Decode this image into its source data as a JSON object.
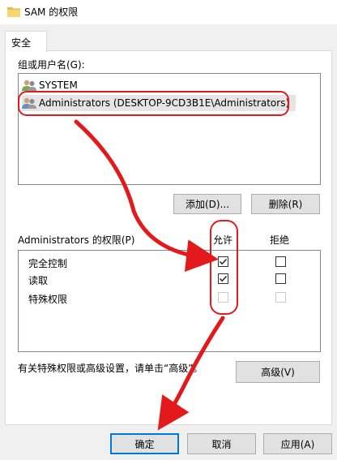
{
  "window": {
    "title": "SAM 的权限"
  },
  "tabs": [
    {
      "label": "安全"
    }
  ],
  "groups": {
    "label": "组或用户名(G):",
    "items": [
      {
        "name": "SYSTEM"
      },
      {
        "name": "Administrators (DESKTOP-9CD3B1E\\Administrators)"
      }
    ]
  },
  "buttons": {
    "add": "添加(D)...",
    "remove": "删除(R)",
    "advanced": "高级(V)",
    "ok": "确定",
    "cancel": "取消",
    "apply": "应用(A)"
  },
  "permissions": {
    "title": "Administrators 的权限(P)",
    "allow_label": "允许",
    "deny_label": "拒绝",
    "rows": [
      {
        "name": "完全控制",
        "allow": true,
        "deny": false,
        "enabled": true
      },
      {
        "name": "读取",
        "allow": true,
        "deny": false,
        "enabled": true
      },
      {
        "name": "特殊权限",
        "allow": false,
        "deny": false,
        "enabled": false
      }
    ]
  },
  "advanced_hint": "有关特殊权限或高级设置，请单击“高级”。",
  "annotation_color": "#e31a1c"
}
